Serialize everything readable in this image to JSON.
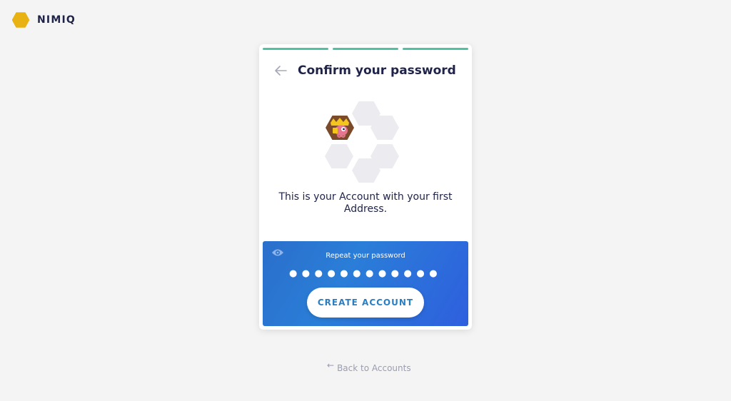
{
  "brand": {
    "name": "NIMIQ",
    "logo_icon": "nimiq-hexagon-icon",
    "logo_color": "#e9b213"
  },
  "progress": {
    "steps_total": 3,
    "steps_completed": 3,
    "color": "#4fc0a4"
  },
  "card": {
    "back_icon": "arrow-left-icon",
    "title": "Confirm your password",
    "message": "This is your Account with your first Address.",
    "identicons": {
      "count": 6,
      "filled": 1,
      "placeholder_color": "#ececf0"
    }
  },
  "password_panel": {
    "visibility_icon": "eye-icon",
    "label": "Repeat your password",
    "masked_value": "●●●●●●●●●●●●",
    "button_label": "CREATE ACCOUNT",
    "gradient_start": "#2a6fcb",
    "gradient_end": "#2e5fde"
  },
  "footer": {
    "back_arrow": "←",
    "back_label": "Back to Accounts"
  }
}
